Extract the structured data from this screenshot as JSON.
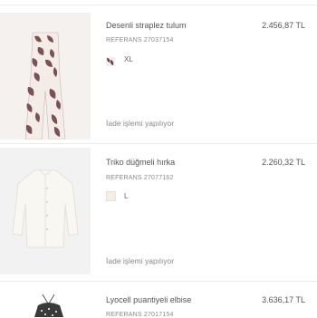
{
  "items": [
    {
      "name": "Desenli straplez tulum",
      "price": "2.456,87 TL",
      "reference": "REFERANS 27037154",
      "size": "XL",
      "return_status": "İade işlemi yapılıyor",
      "colors": {
        "swatch": "#6b3f49",
        "pattern_bg": "#f4ece6",
        "pattern_fg": "#7a5156"
      }
    },
    {
      "name": "Triko düğmeli hırka",
      "price": "2.260,32 TL",
      "reference": "REFERANS 27077162",
      "size": "L",
      "return_status": "İade işlemi yapılıyor",
      "colors": {
        "swatch": "#f3efe6",
        "cardigan": "#f7f5ee"
      }
    },
    {
      "name": "Lyocell puantiyeli elbise",
      "price": "3.636,17 TL",
      "reference": "REFERANS 27017154",
      "colors": {
        "dress": "#3a3a3a"
      }
    }
  ]
}
